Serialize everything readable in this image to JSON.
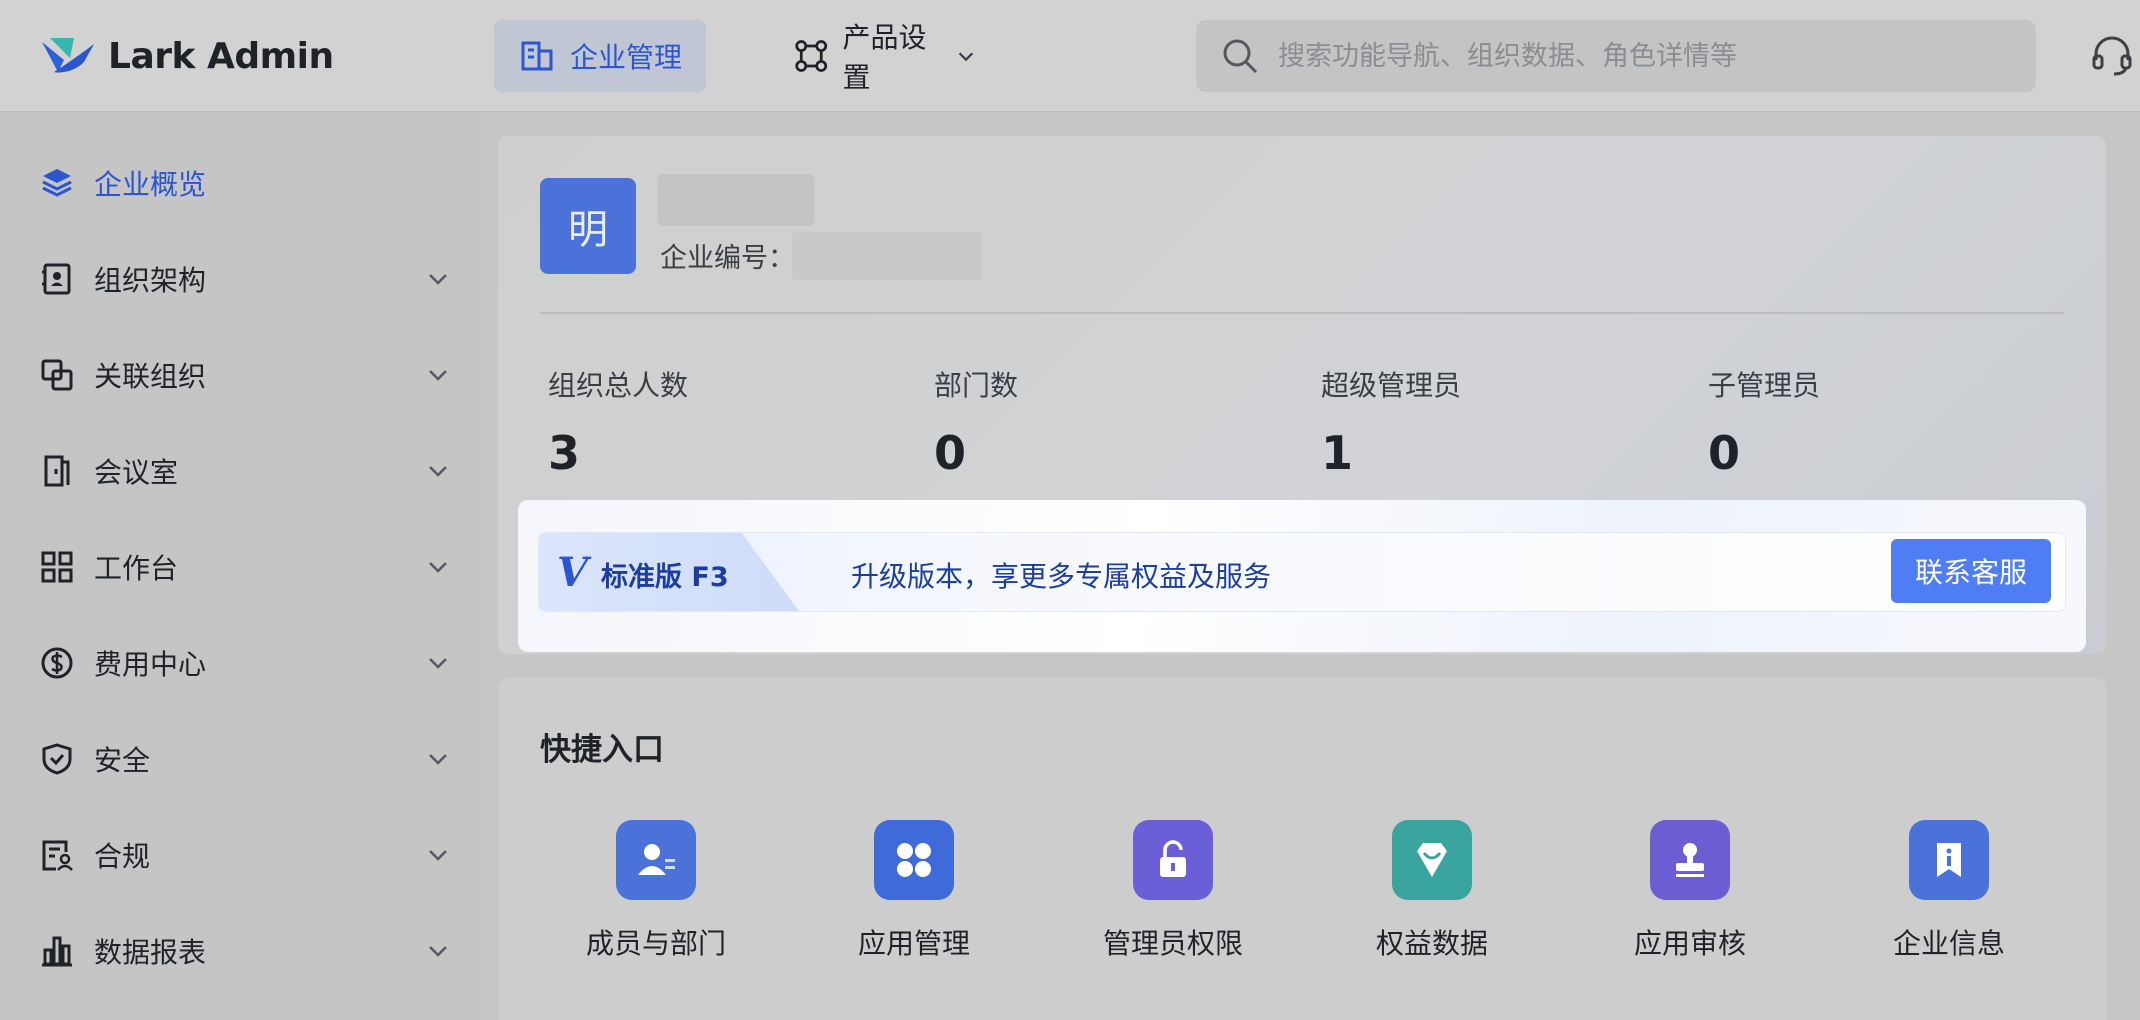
{
  "topbar": {
    "brand": "Lark Admin",
    "nav": [
      {
        "label": "企业管理",
        "active": true
      },
      {
        "label": "产品设置",
        "active": false
      }
    ],
    "search_placeholder": "搜索功能导航、组织数据、角色详情等"
  },
  "sidebar": {
    "items": [
      {
        "label": "企业概览",
        "icon": "layers-icon",
        "active": true
      },
      {
        "label": "组织架构",
        "icon": "contact-card-icon"
      },
      {
        "label": "关联组织",
        "icon": "linked-squares-icon"
      },
      {
        "label": "会议室",
        "icon": "door-icon"
      },
      {
        "label": "工作台",
        "icon": "grid-icon"
      },
      {
        "label": "费用中心",
        "icon": "dollar-icon"
      },
      {
        "label": "安全",
        "icon": "shield-icon"
      },
      {
        "label": "合规",
        "icon": "document-person-icon"
      },
      {
        "label": "数据报表",
        "icon": "bar-chart-icon"
      }
    ]
  },
  "enterprise": {
    "avatar_char": "明",
    "id_label": "企业编号："
  },
  "stats": [
    {
      "label": "组织总人数",
      "value": "3"
    },
    {
      "label": "部门数",
      "value": "0"
    },
    {
      "label": "超级管理员",
      "value": "1"
    },
    {
      "label": "子管理员",
      "value": "0"
    }
  ],
  "upgrade": {
    "version_mark": "V",
    "version_name": "标准版 F3",
    "message": "升级版本，享更多专属权益及服务",
    "button": "联系客服"
  },
  "quick_entry": {
    "title": "快捷入口",
    "items": [
      {
        "label": "成员与部门",
        "icon": "members-icon",
        "color": "#4a72d8"
      },
      {
        "label": "应用管理",
        "icon": "apps-icon",
        "color": "#3f6ad9"
      },
      {
        "label": "管理员权限",
        "icon": "unlock-icon",
        "color": "#6a5fd6"
      },
      {
        "label": "权益数据",
        "icon": "gem-icon",
        "color": "#3aa59e"
      },
      {
        "label": "应用审核",
        "icon": "stamp-icon",
        "color": "#6c5dd3"
      },
      {
        "label": "企业信息",
        "icon": "info-badge-icon",
        "color": "#4a72d8"
      }
    ]
  },
  "colors": {
    "accent": "#2b56cf",
    "button": "#4f7df3"
  }
}
